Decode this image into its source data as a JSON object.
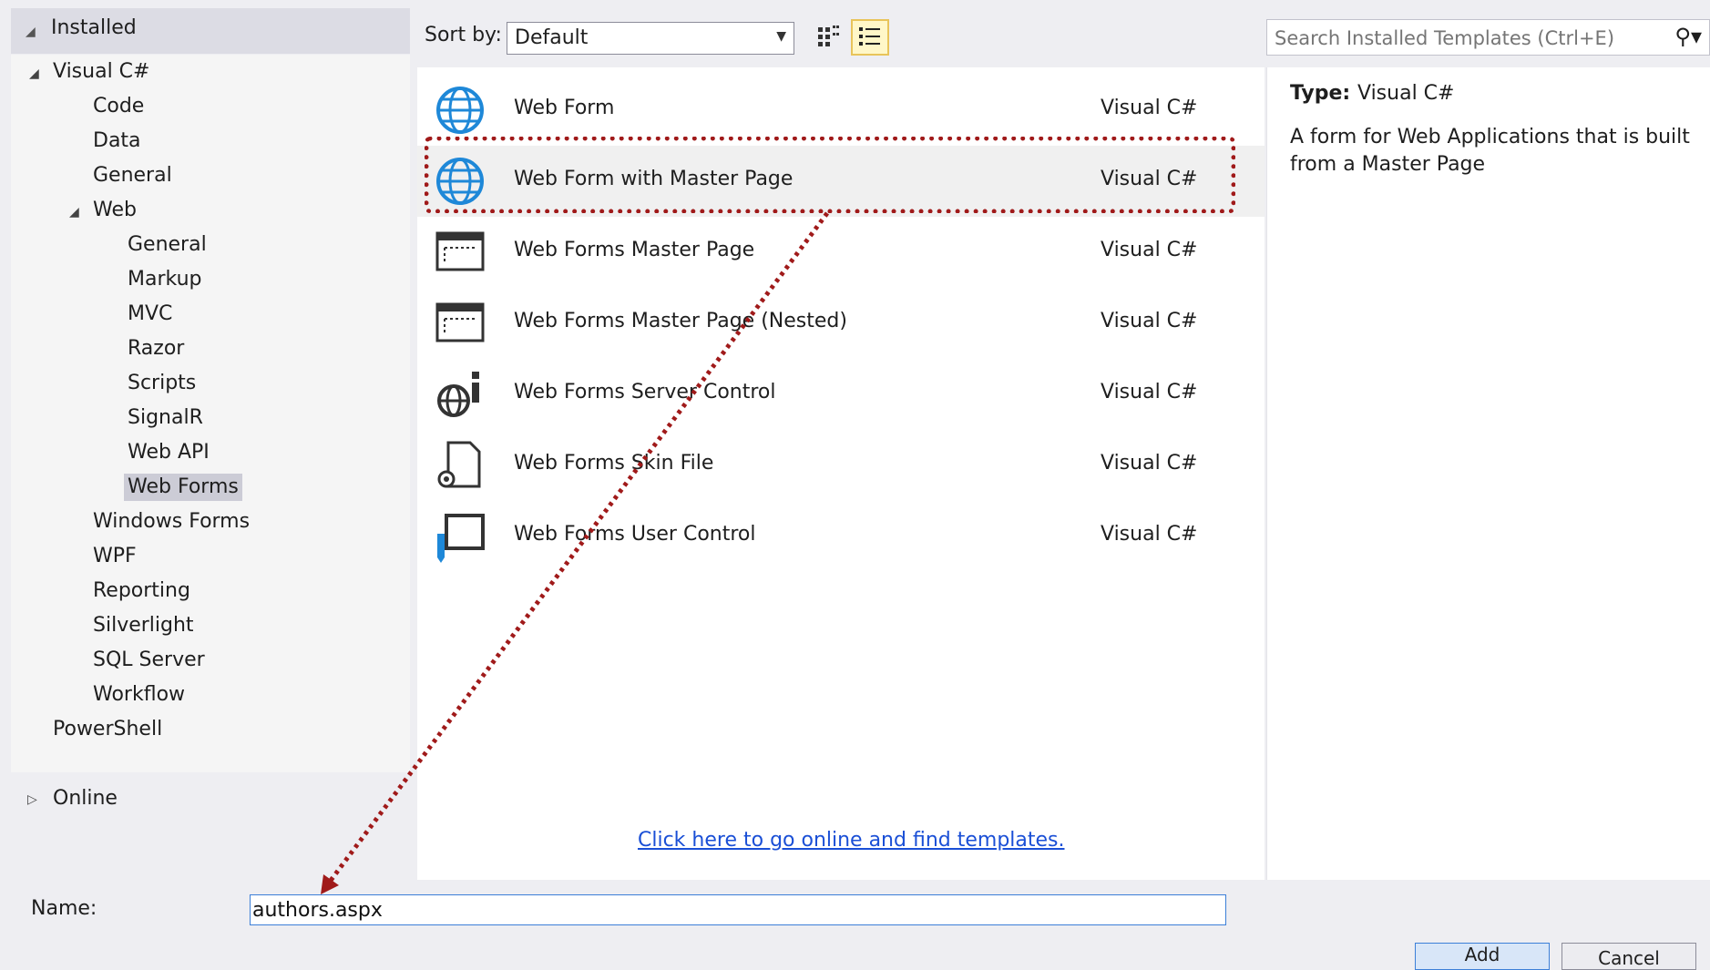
{
  "tree": {
    "installed_label": "Installed",
    "items": [
      {
        "label": "Visual C#",
        "indent": 0,
        "expander": "down"
      },
      {
        "label": "Code",
        "indent": 1
      },
      {
        "label": "Data",
        "indent": 1
      },
      {
        "label": "General",
        "indent": 1
      },
      {
        "label": "Web",
        "indent": 1,
        "expander": "down"
      },
      {
        "label": "General",
        "indent": 2
      },
      {
        "label": "Markup",
        "indent": 2
      },
      {
        "label": "MVC",
        "indent": 2
      },
      {
        "label": "Razor",
        "indent": 2
      },
      {
        "label": "Scripts",
        "indent": 2
      },
      {
        "label": "SignalR",
        "indent": 2
      },
      {
        "label": "Web API",
        "indent": 2
      },
      {
        "label": "Web Forms",
        "indent": 2,
        "selected": true
      },
      {
        "label": "Windows Forms",
        "indent": 1
      },
      {
        "label": "WPF",
        "indent": 1
      },
      {
        "label": "Reporting",
        "indent": 1
      },
      {
        "label": "Silverlight",
        "indent": 1
      },
      {
        "label": "SQL Server",
        "indent": 1
      },
      {
        "label": "Workflow",
        "indent": 1
      },
      {
        "label": "PowerShell",
        "indent": 0
      }
    ],
    "online_label": "Online"
  },
  "toolbar": {
    "sort_label": "Sort by:",
    "sort_value": "Default",
    "search_placeholder": "Search Installed Templates (Ctrl+E)"
  },
  "templates": [
    {
      "name": "Web Form",
      "lang": "Visual C#",
      "icon": "globe-icon"
    },
    {
      "name": "Web Form with Master Page",
      "lang": "Visual C#",
      "icon": "globe-icon",
      "selected": true
    },
    {
      "name": "Web Forms Master Page",
      "lang": "Visual C#",
      "icon": "master-page-icon"
    },
    {
      "name": "Web Forms Master Page (Nested)",
      "lang": "Visual C#",
      "icon": "master-page-icon"
    },
    {
      "name": "Web Forms Server Control",
      "lang": "Visual C#",
      "icon": "server-control-icon"
    },
    {
      "name": "Web Forms Skin File",
      "lang": "Visual C#",
      "icon": "skin-file-icon"
    },
    {
      "name": "Web Forms User Control",
      "lang": "Visual C#",
      "icon": "user-control-icon"
    }
  ],
  "online_link": "Click here to go online and find templates.",
  "details": {
    "type_label": "Type:",
    "type_value": "Visual C#",
    "description": "A form for Web Applications that is built from a Master Page"
  },
  "name_field": {
    "label": "Name:",
    "value": "authors.aspx"
  },
  "buttons": {
    "add": "Add",
    "cancel": "Cancel"
  },
  "colors": {
    "accent": "#3c7fd8",
    "annotation": "#a01a1a",
    "link": "#1a4fd6"
  }
}
